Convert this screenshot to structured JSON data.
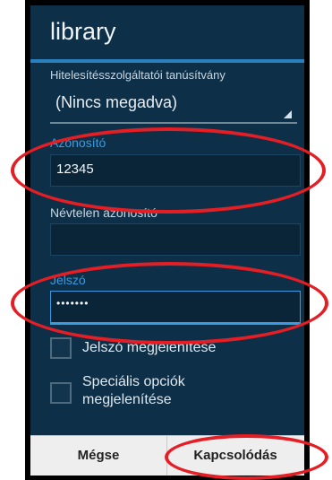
{
  "dialog": {
    "title": "library",
    "cert_label": "Hitelesítésszolgáltatói tanúsítvány",
    "cert_value": "(Nincs megadva)",
    "identity_label": "Azonosító",
    "identity_value": "12345",
    "anon_label": "Névtelen azonosító",
    "anon_value": "",
    "password_label": "Jelszó",
    "password_value": "•••••••",
    "show_password_label": "Jelszó megjelenítése",
    "advanced_label_line1": "Speciális opciók",
    "advanced_label_line2": "megjelenítése"
  },
  "buttons": {
    "cancel": "Mégse",
    "connect": "Kapcsolódás"
  },
  "colors": {
    "dialog_bg": "#0d2f47",
    "accent": "#3b9be0",
    "highlight": "#e41e25"
  }
}
